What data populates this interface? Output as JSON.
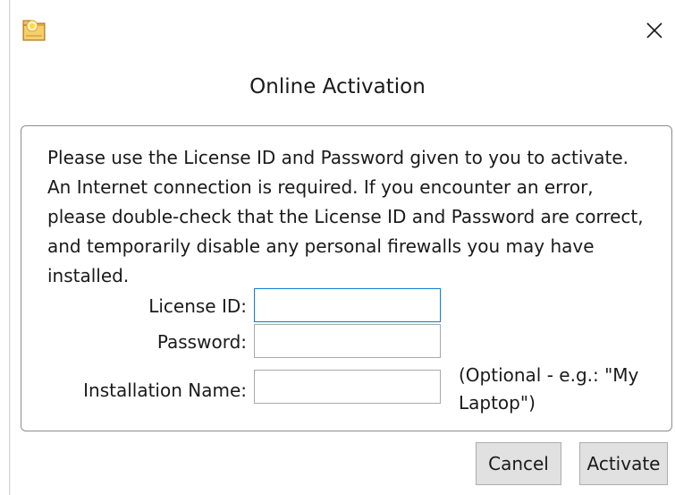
{
  "window": {
    "title": "Online Activation",
    "app_icon": "folder-sun-icon",
    "close_icon": "close-icon"
  },
  "instructions": "Please use the License ID and Password given to you to activate. An Internet connection is required.  If you encounter an error, please double-check that the License ID and Password are correct, and temporarily disable any personal firewalls you may have installed.",
  "form": {
    "license_id": {
      "label": "License ID:",
      "value": "",
      "placeholder": ""
    },
    "password": {
      "label": "Password:",
      "value": "",
      "placeholder": ""
    },
    "installation_name": {
      "label": "Installation Name:",
      "value": "",
      "placeholder": "",
      "hint": "(Optional - e.g.: \"My Laptop\")"
    }
  },
  "buttons": {
    "cancel": "Cancel",
    "activate": "Activate"
  },
  "colors": {
    "focus_border": "#0f7bd8",
    "button_bg": "#e1e1e1"
  }
}
